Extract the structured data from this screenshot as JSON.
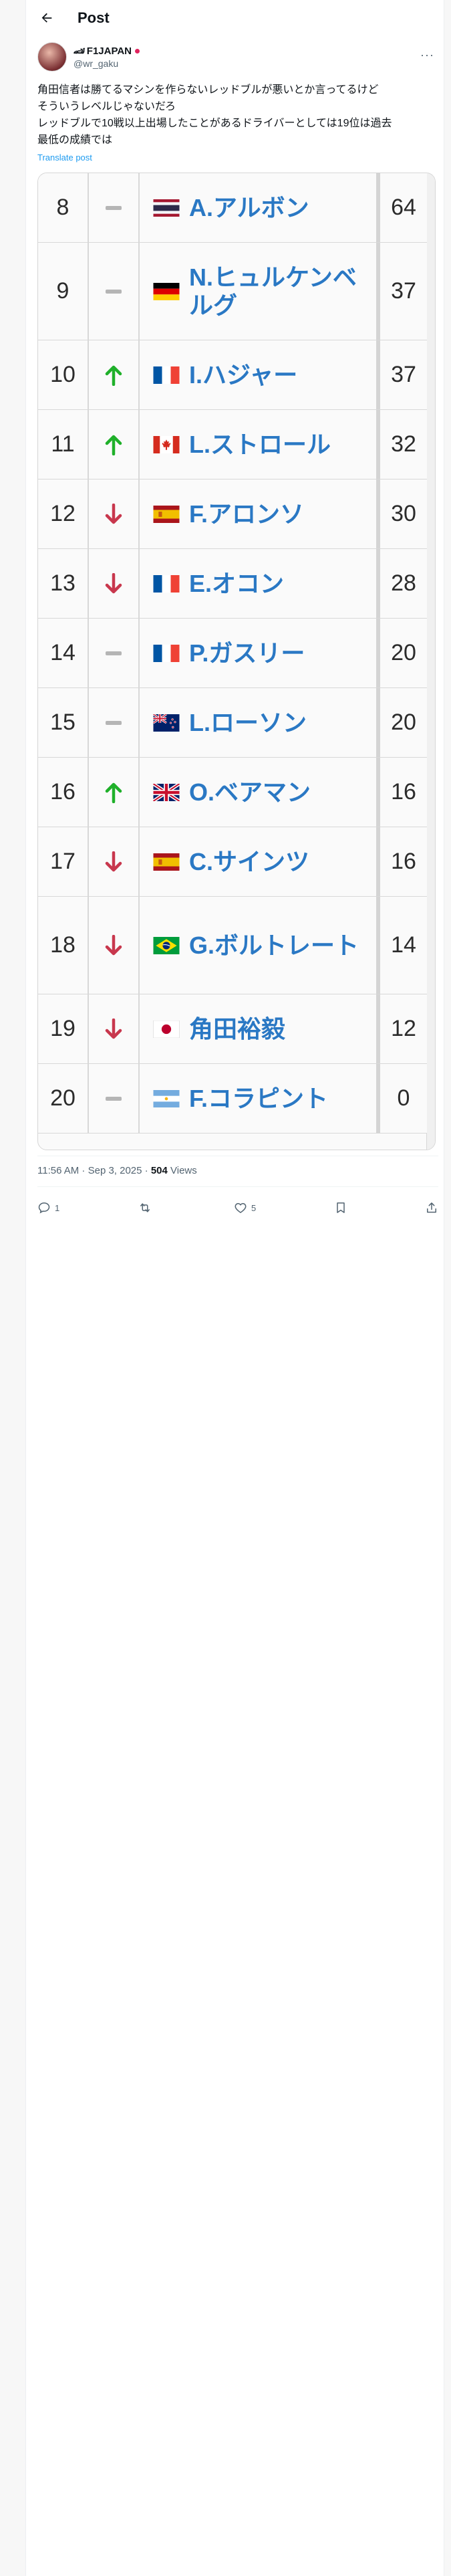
{
  "header": {
    "title": "Post",
    "back_icon": "arrow-left-icon"
  },
  "author": {
    "badge": "🏎",
    "name": "F1JAPAN",
    "handle": "@wr_gaku",
    "more_icon": "more-icon"
  },
  "post": {
    "lines": [
      "角田信者は勝てるマシンを作らないレッドブルが悪いとか言ってるけど",
      "そういうレベルじゃないだろ",
      "レッドブルで10戦以上出場したことがあるドライバーとしては19位は過去",
      "最低の成績では"
    ],
    "translate": "Translate post"
  },
  "standings": {
    "rows": [
      {
        "pos": "8",
        "trend": "same",
        "flag": "thailand",
        "driver": "A.アルボン",
        "points": "64"
      },
      {
        "pos": "9",
        "trend": "same",
        "flag": "germany",
        "driver": "N.ヒュルケンベルグ",
        "points": "37"
      },
      {
        "pos": "10",
        "trend": "up",
        "flag": "france",
        "driver": "I.ハジャー",
        "points": "37"
      },
      {
        "pos": "11",
        "trend": "up",
        "flag": "canada",
        "driver": "L.ストロール",
        "points": "32"
      },
      {
        "pos": "12",
        "trend": "down",
        "flag": "spain",
        "driver": "F.アロンソ",
        "points": "30"
      },
      {
        "pos": "13",
        "trend": "down",
        "flag": "france",
        "driver": "E.オコン",
        "points": "28"
      },
      {
        "pos": "14",
        "trend": "same",
        "flag": "france",
        "driver": "P.ガスリー",
        "points": "20"
      },
      {
        "pos": "15",
        "trend": "same",
        "flag": "newzealand",
        "driver": "L.ローソン",
        "points": "20"
      },
      {
        "pos": "16",
        "trend": "up",
        "flag": "uk",
        "driver": "O.ベアマン",
        "points": "16"
      },
      {
        "pos": "17",
        "trend": "down",
        "flag": "spain",
        "driver": "C.サインツ",
        "points": "16"
      },
      {
        "pos": "18",
        "trend": "down",
        "flag": "brazil",
        "driver": "G.ボルトレート",
        "points": "14"
      },
      {
        "pos": "19",
        "trend": "down",
        "flag": "japan",
        "driver": "角田裕毅",
        "points": "12"
      },
      {
        "pos": "20",
        "trend": "same",
        "flag": "argentina",
        "driver": "F.コラピント",
        "points": "0"
      }
    ]
  },
  "meta": {
    "time": "11:56 AM · Sep 3, 2025 · ",
    "views_count": "504",
    "views_label": " Views"
  },
  "actions": {
    "reply_count": "1",
    "repost_count": "",
    "like_count": "5"
  },
  "colors": {
    "accent": "#1d9bf0",
    "driver_name": "#2a78c4",
    "trend_up": "#1fb02a",
    "trend_down": "#c8374d",
    "trend_same": "#b5b5b5"
  }
}
